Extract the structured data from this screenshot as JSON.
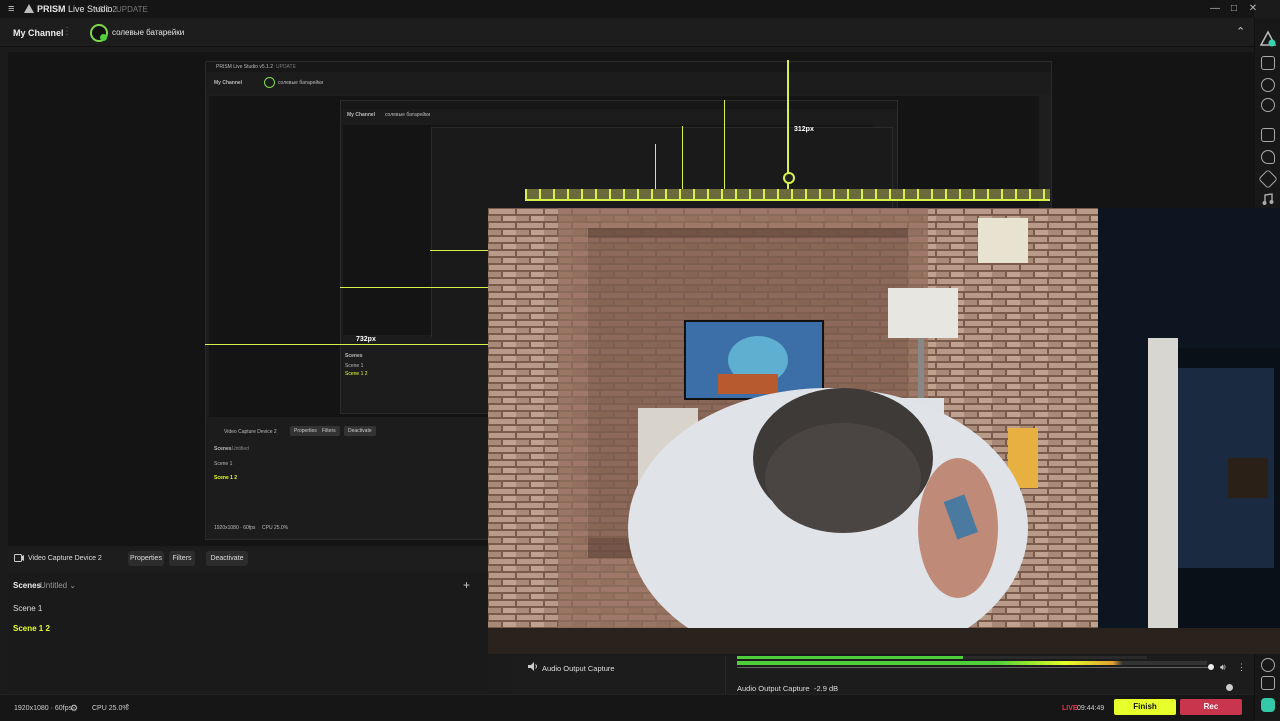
{
  "app": {
    "menu_glyph": "≡",
    "name": "PRISM",
    "subname": "Live Studio",
    "version": "v5.1.2",
    "update_label": "UPDATE"
  },
  "window_controls": {
    "minimize": "—",
    "maximize": "□",
    "close": "✕"
  },
  "channel": {
    "my_channel": "My Channel",
    "more": "⋮",
    "channel_name": "солевые батарейки",
    "collapse_glyph": "⌃"
  },
  "nested": {
    "app_name": "PRISM Live Studio v5.1.2",
    "update": "UPDATE",
    "my_channel": "My Channel",
    "channel_name": "солевые батарейки",
    "source": "Video Capture Device 2",
    "btn_properties": "Properties",
    "btn_filters": "Filters",
    "btn_deactivate": "Deactivate",
    "scenes": "Scenes",
    "untitled": "Untitled",
    "scene1": "Scene 1",
    "scene12": "Scene 1 2",
    "resolution": "1920x1080 · 60fps",
    "cpu": "CPU 25.0%",
    "dim_312": "312px",
    "dim_732": "732px"
  },
  "source": {
    "name": "Video Capture Device 2",
    "properties": "Properties",
    "filters": "Filters",
    "deactivate": "Deactivate"
  },
  "scenes": {
    "title": "Scenes",
    "collection": "Untitled",
    "add": "+",
    "items": [
      {
        "label": "Scene 1",
        "active": false
      },
      {
        "label": "Scene 1 2",
        "active": true
      }
    ]
  },
  "audio": {
    "source_name": "Audio Output Capture",
    "mixer_label": "Audio Output Capture",
    "mixer_db": "-2.9 dB"
  },
  "status": {
    "resolution": "1920x1080 · 60fps",
    "cpu": "CPU 25.0%",
    "live_label": "LIVE",
    "live_time": "09:44:49",
    "finish": "Finish",
    "rec": "Rec"
  },
  "colors": {
    "accent": "#e7ff2a",
    "rec": "#c9354d",
    "live": "#e0344a",
    "channel_green": "#4fcf3a"
  }
}
